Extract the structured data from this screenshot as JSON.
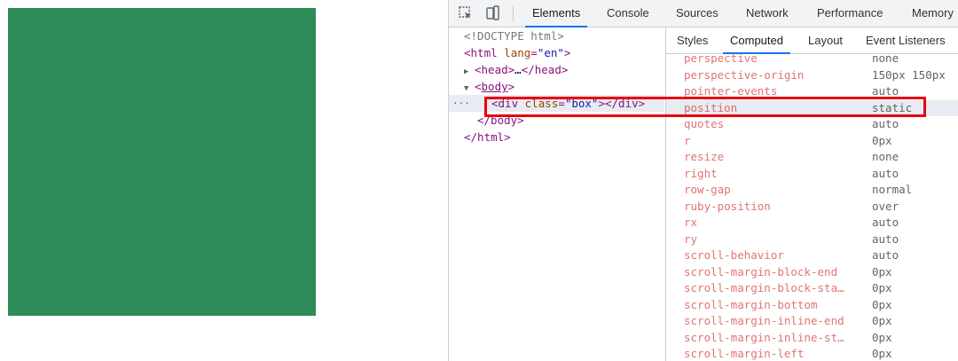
{
  "toolbar": {
    "icons": [
      "inspect-element-icon",
      "device-toolbar-icon"
    ],
    "tabs": [
      {
        "label": "Elements",
        "active": true
      },
      {
        "label": "Console"
      },
      {
        "label": "Sources"
      },
      {
        "label": "Network"
      },
      {
        "label": "Performance"
      },
      {
        "label": "Memory"
      }
    ]
  },
  "dom_tree": {
    "doctype": "<!DOCTYPE html>",
    "html_tag": "html",
    "html_attr": "lang",
    "html_attr_value": "\"en\"",
    "head_open": "<head>",
    "head_ellipsis": "…",
    "head_close": "</head>",
    "body_tag": "body",
    "div_tag": "div",
    "div_attr": "class",
    "div_attr_value": "\"box\"",
    "div_close": "</div>",
    "body_close": "</body>",
    "html_close": "</html>",
    "dots": "···"
  },
  "side_tabs": [
    {
      "label": "Styles"
    },
    {
      "label": "Computed",
      "active": true
    },
    {
      "label": "Layout"
    },
    {
      "label": "Event Listeners"
    }
  ],
  "computed_properties": [
    {
      "name": "perspective",
      "value": "none"
    },
    {
      "name": "perspective-origin",
      "value": "150px 150px"
    },
    {
      "name": "pointer-events",
      "value": "auto"
    },
    {
      "name": "position",
      "value": "static",
      "highlighted": true
    },
    {
      "name": "quotes",
      "value": "auto"
    },
    {
      "name": "r",
      "value": "0px"
    },
    {
      "name": "resize",
      "value": "none"
    },
    {
      "name": "right",
      "value": "auto"
    },
    {
      "name": "row-gap",
      "value": "normal"
    },
    {
      "name": "ruby-position",
      "value": "over"
    },
    {
      "name": "rx",
      "value": "auto"
    },
    {
      "name": "ry",
      "value": "auto"
    },
    {
      "name": "scroll-behavior",
      "value": "auto"
    },
    {
      "name": "scroll-margin-block-end",
      "value": "0px"
    },
    {
      "name": "scroll-margin-block-sta…",
      "value": "0px"
    },
    {
      "name": "scroll-margin-bottom",
      "value": "0px"
    },
    {
      "name": "scroll-margin-inline-end",
      "value": "0px"
    },
    {
      "name": "scroll-margin-inline-st…",
      "value": "0px"
    },
    {
      "name": "scroll-margin-left",
      "value": "0px"
    }
  ],
  "colors": {
    "box": "#2e8b57",
    "annotation": "#e8000b",
    "accent": "#1a73e8"
  }
}
